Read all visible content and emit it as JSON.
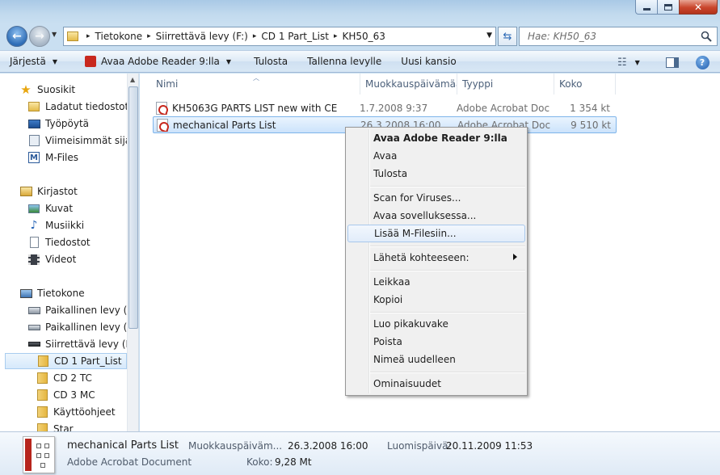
{
  "window": {
    "minimize": "minimize",
    "maximize": "maximize",
    "close": "close"
  },
  "address": {
    "crumbs": [
      "Tietokone",
      "Siirrettävä levy (F:)",
      "CD 1 Part_List",
      "KH50_63"
    ]
  },
  "search": {
    "placeholder": "Hae: KH50_63"
  },
  "toolbar": {
    "organize": "Järjestä",
    "open_with": "Avaa Adobe Reader 9:lla",
    "print": "Tulosta",
    "burn": "Tallenna levylle",
    "new_folder": "Uusi kansio"
  },
  "navpane": {
    "favorites": "Suosikit",
    "downloads": "Ladatut tiedostot",
    "desktop": "Työpöytä",
    "recent": "Viimeisimmät sijainnit",
    "mfiles": "M-Files",
    "libraries": "Kirjastot",
    "pictures": "Kuvat",
    "music": "Musiikki",
    "documents": "Tiedostot",
    "videos": "Videot",
    "computer": "Tietokone",
    "local_c": "Paikallinen levy (C:)",
    "local_d": "Paikallinen levy (D:)",
    "removable_f": "Siirrettävä levy (F:)",
    "cd1": "CD 1 Part_List",
    "cd2": "CD 2 TC",
    "cd3": "CD 3 MC",
    "manuals": "Käyttöohjeet",
    "star": "Star"
  },
  "columns": {
    "name": "Nimi",
    "modified": "Muokkauspäivämäärä",
    "type": "Tyyppi",
    "size": "Koko"
  },
  "files": [
    {
      "name": "KH5063G PARTS LIST new with CE",
      "modified": "1.7.2008 9:37",
      "type": "Adobe Acrobat Document",
      "size": "1 354 kt"
    },
    {
      "name": "mechanical Parts List",
      "modified": "26.3.2008 16:00",
      "type": "Adobe Acrobat Document",
      "size": "9 510 kt"
    }
  ],
  "context_menu": {
    "open_reader": "Avaa Adobe Reader 9:lla",
    "open": "Avaa",
    "print": "Tulosta",
    "scan": "Scan for Viruses...",
    "open_with": "Avaa sovelluksessa...",
    "add_mfiles": "Lisää M-Filesiin...",
    "send_to": "Lähetä kohteeseen:",
    "cut": "Leikkaa",
    "copy": "Kopioi",
    "shortcut": "Luo pikakuvake",
    "delete": "Poista",
    "rename": "Nimeä uudelleen",
    "properties": "Ominaisuudet"
  },
  "details": {
    "name": "mechanical Parts List",
    "type": "Adobe Acrobat Document",
    "modified_label": "Muokkauspäiväm...",
    "modified_value": "26.3.2008 16:00",
    "size_label": "Koko:",
    "size_value": "9,28 Mt",
    "created_label": "Luomispäivä:",
    "created_value": "20.11.2009 11:53"
  },
  "colors": {
    "accent": "#3a7bd5",
    "selection": "#cce3fb",
    "pdf_red": "#c8281e",
    "close_red": "#c9452c"
  }
}
